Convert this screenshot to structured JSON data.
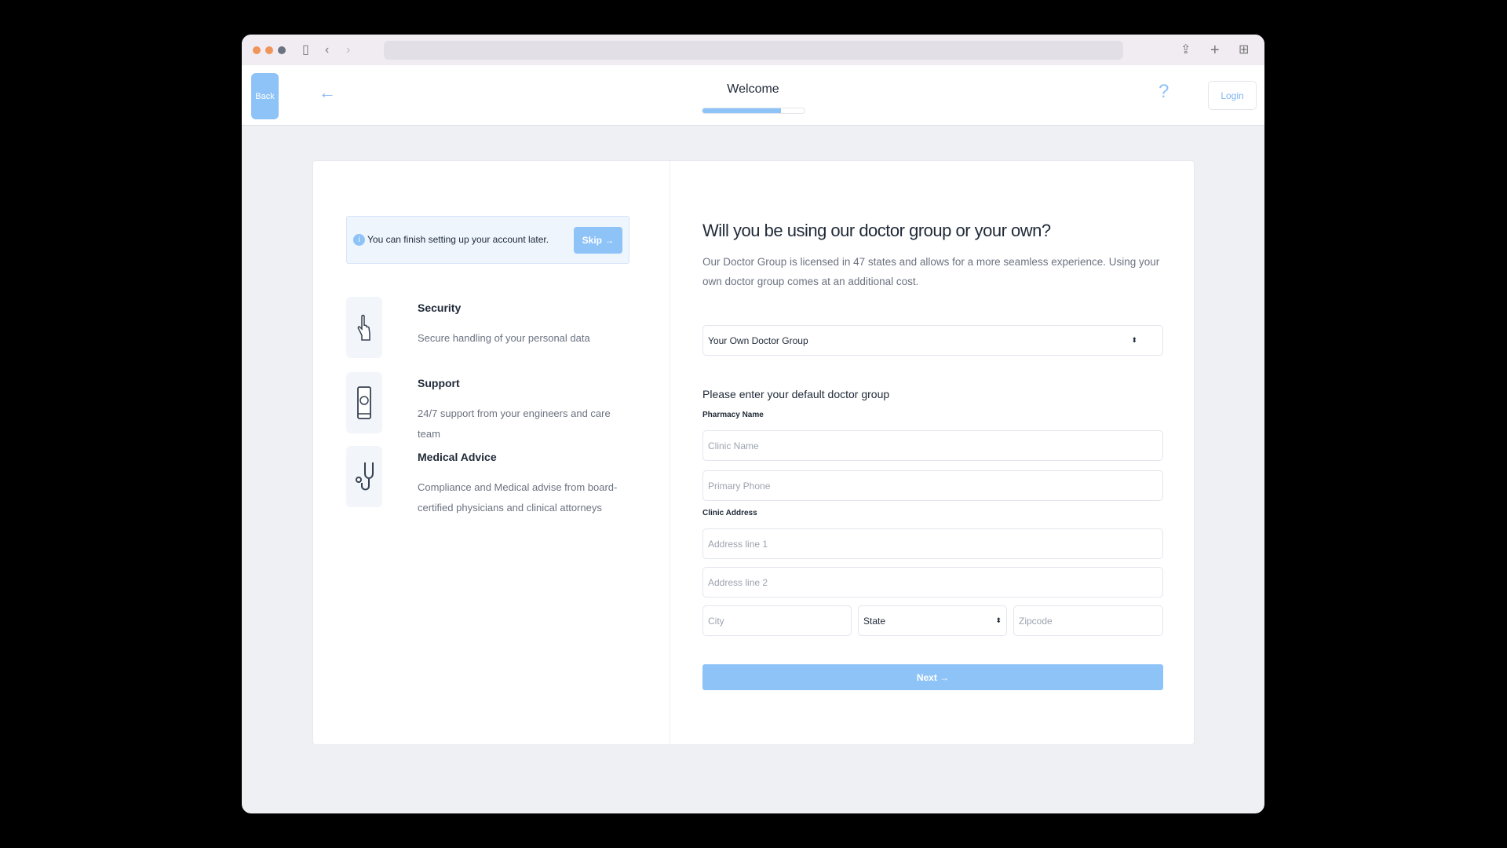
{
  "browser": {
    "icons": [
      "sidebar-icon",
      "back-icon",
      "forward-icon",
      "share-icon",
      "new-tab-icon",
      "tabs-grid-icon"
    ]
  },
  "header": {
    "logo_text": "Back",
    "title": "Welcome",
    "progress_percent": 77,
    "help": "?",
    "login": "Login"
  },
  "banner": {
    "text": "You can finish setting up your account later.",
    "skip": "Skip →"
  },
  "features": [
    {
      "title": "Security",
      "desc": "Secure handling of your personal data",
      "icon": "hand-touch-icon"
    },
    {
      "title": "Support",
      "desc": "24/7 support from your engineers and care team",
      "icon": "phone-icon"
    },
    {
      "title": "Medical Advice",
      "desc": "Compliance and Medical advise from board-certified physicians and clinical attorneys",
      "icon": "stethoscope-icon"
    }
  ],
  "form": {
    "title": "Will you be using our doctor group or your own?",
    "description": "Our Doctor Group is licensed in 47 states and allows for a more seamless experience. Using your own doctor group comes at an additional cost.",
    "group_select": "Your Own Doctor Group",
    "subtitle": "Please enter your default doctor group",
    "pharmacy_label": "Pharmacy Name",
    "clinic_name_placeholder": "Clinic Name",
    "phone_placeholder": "Primary Phone",
    "address_label": "Clinic Address",
    "address1_placeholder": "Address line 1",
    "address2_placeholder": "Address line 2",
    "city_placeholder": "City",
    "state_select": "State",
    "zip_placeholder": "Zipcode",
    "next": "Next →"
  },
  "colors": {
    "accent": "#8ec3f8"
  }
}
